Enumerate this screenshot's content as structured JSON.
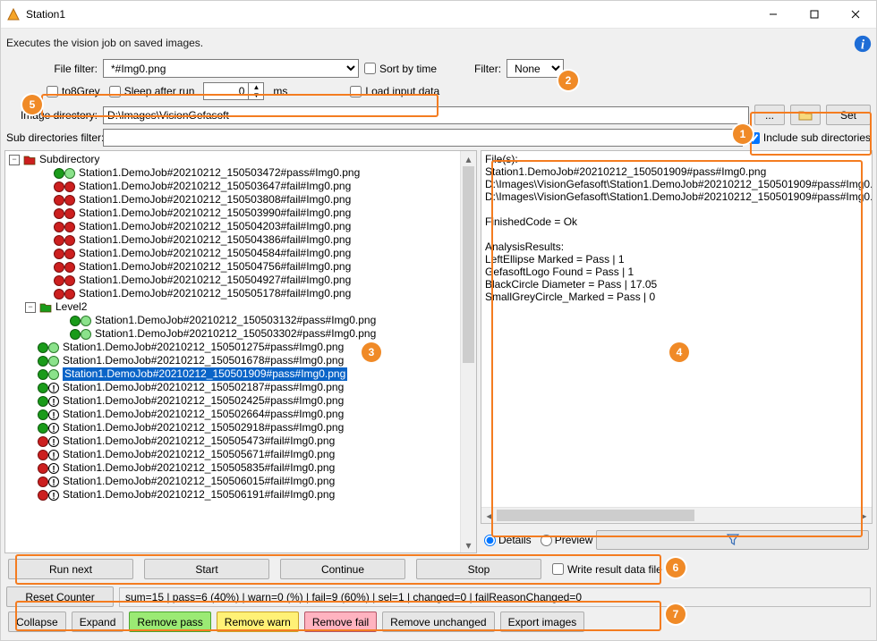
{
  "window": {
    "title": "Station1"
  },
  "description": "Executes the vision job on saved images.",
  "filterRow": {
    "file_filter_label": "File filter:",
    "file_filter_value": "*#Img0.png",
    "sort_by_time_label": "Sort by time",
    "filter_label": "Filter:",
    "filter_selected": "None"
  },
  "optionsRow": {
    "to8grey_label": "to8Grey",
    "sleep_after_run_label": "Sleep after run",
    "sleep_value": "0",
    "sleep_unit": "ms",
    "load_input_data_label": "Load input data"
  },
  "directoryRow": {
    "image_dir_label": "Image directory:",
    "image_dir_value": "D:\\Images\\VisionGefasoft",
    "browse_label": "...",
    "set_label": "Set"
  },
  "subDirRow": {
    "label": "Sub directories filter:",
    "value": "",
    "include_subdirs_label": "Include sub directories",
    "include_subdirs_checked": true
  },
  "callouts": [
    "1",
    "2",
    "3",
    "4",
    "5",
    "6",
    "7"
  ],
  "tree": {
    "root": {
      "label": "Subdirectory",
      "expanded": true,
      "status": [
        "cg"
      ]
    },
    "items": [
      {
        "label": "Station1.DemoJob#20210212_150503472#pass#Img0.png",
        "status": [
          "g",
          "cg"
        ],
        "depth": 2
      },
      {
        "label": "Station1.DemoJob#20210212_150503647#fail#Img0.png",
        "status": [
          "r",
          "r"
        ],
        "depth": 2
      },
      {
        "label": "Station1.DemoJob#20210212_150503808#fail#Img0.png",
        "status": [
          "r",
          "r"
        ],
        "depth": 2
      },
      {
        "label": "Station1.DemoJob#20210212_150503990#fail#Img0.png",
        "status": [
          "r",
          "r"
        ],
        "depth": 2
      },
      {
        "label": "Station1.DemoJob#20210212_150504203#fail#Img0.png",
        "status": [
          "r",
          "r"
        ],
        "depth": 2
      },
      {
        "label": "Station1.DemoJob#20210212_150504386#fail#Img0.png",
        "status": [
          "r",
          "r"
        ],
        "depth": 2
      },
      {
        "label": "Station1.DemoJob#20210212_150504584#fail#Img0.png",
        "status": [
          "r",
          "r"
        ],
        "depth": 2
      },
      {
        "label": "Station1.DemoJob#20210212_150504756#fail#Img0.png",
        "status": [
          "r",
          "r"
        ],
        "depth": 2
      },
      {
        "label": "Station1.DemoJob#20210212_150504927#fail#Img0.png",
        "status": [
          "r",
          "r"
        ],
        "depth": 2
      },
      {
        "label": "Station1.DemoJob#20210212_150505178#fail#Img0.png",
        "status": [
          "r",
          "r"
        ],
        "depth": 2
      }
    ],
    "level2": {
      "label": "Level2",
      "items": [
        {
          "label": "Station1.DemoJob#20210212_150503132#pass#Img0.png",
          "status": [
            "g",
            "cg"
          ],
          "depth": 3
        },
        {
          "label": "Station1.DemoJob#20210212_150503302#pass#Img0.png",
          "status": [
            "g",
            "cg"
          ],
          "depth": 3
        }
      ]
    },
    "rootItems": [
      {
        "label": "Station1.DemoJob#20210212_150501275#pass#Img0.png",
        "status": [
          "g",
          "cg"
        ],
        "depth": 1
      },
      {
        "label": "Station1.DemoJob#20210212_150501678#pass#Img0.png",
        "status": [
          "g",
          "cg"
        ],
        "depth": 1
      },
      {
        "label": "Station1.DemoJob#20210212_150501909#pass#Img0.png",
        "status": [
          "g",
          "cg"
        ],
        "depth": 1,
        "selected": true
      },
      {
        "label": "Station1.DemoJob#20210212_150502187#pass#Img0.png",
        "status": [
          "g",
          "ex"
        ],
        "depth": 1
      },
      {
        "label": "Station1.DemoJob#20210212_150502425#pass#Img0.png",
        "status": [
          "g",
          "ex"
        ],
        "depth": 1
      },
      {
        "label": "Station1.DemoJob#20210212_150502664#pass#Img0.png",
        "status": [
          "g",
          "ex"
        ],
        "depth": 1
      },
      {
        "label": "Station1.DemoJob#20210212_150502918#pass#Img0.png",
        "status": [
          "g",
          "ex"
        ],
        "depth": 1
      },
      {
        "label": "Station1.DemoJob#20210212_150505473#fail#Img0.png",
        "status": [
          "r",
          "ex"
        ],
        "depth": 1
      },
      {
        "label": "Station1.DemoJob#20210212_150505671#fail#Img0.png",
        "status": [
          "r",
          "ex"
        ],
        "depth": 1
      },
      {
        "label": "Station1.DemoJob#20210212_150505835#fail#Img0.png",
        "status": [
          "r",
          "ex"
        ],
        "depth": 1
      },
      {
        "label": "Station1.DemoJob#20210212_150506015#fail#Img0.png",
        "status": [
          "r",
          "ex"
        ],
        "depth": 1
      },
      {
        "label": "Station1.DemoJob#20210212_150506191#fail#Img0.png",
        "status": [
          "r",
          "ex"
        ],
        "depth": 1
      }
    ]
  },
  "details": {
    "text": "File(s):\nStation1.DemoJob#20210212_150501909#pass#Img0.png\nD:\\Images\\VisionGefasoft\\Station1.DemoJob#20210212_150501909#pass#Img0.\nD:\\Images\\VisionGefasoft\\Station1.DemoJob#20210212_150501909#pass#Img0.\n\nFinishedCode = Ok\n\nAnalysisResults:\nLeftEllipse Marked = Pass | 1\nGefasoftLogo Found = Pass | 1\nBlackCircle Diameter = Pass | 17.05\nSmallGreyCircle_Marked = Pass | 0",
    "mode_details": "Details",
    "mode_preview": "Preview"
  },
  "runRow": {
    "run_next": "Run next",
    "start": "Start",
    "continue": "Continue",
    "stop": "Stop",
    "write_result_label": "Write result data file"
  },
  "status": {
    "reset_counter": "Reset Counter",
    "summary": "sum=15  |  pass=6 (40%)  |  warn=0 (%)  |  fail=9 (60%) | sel=1 | changed=0 | failReasonChanged=0"
  },
  "bottom": {
    "collapse": "Collapse",
    "expand": "Expand",
    "remove_pass": "Remove pass",
    "remove_warn": "Remove warn",
    "remove_fail": "Remove fail",
    "remove_unchanged": "Remove unchanged",
    "export_images": "Export images"
  }
}
